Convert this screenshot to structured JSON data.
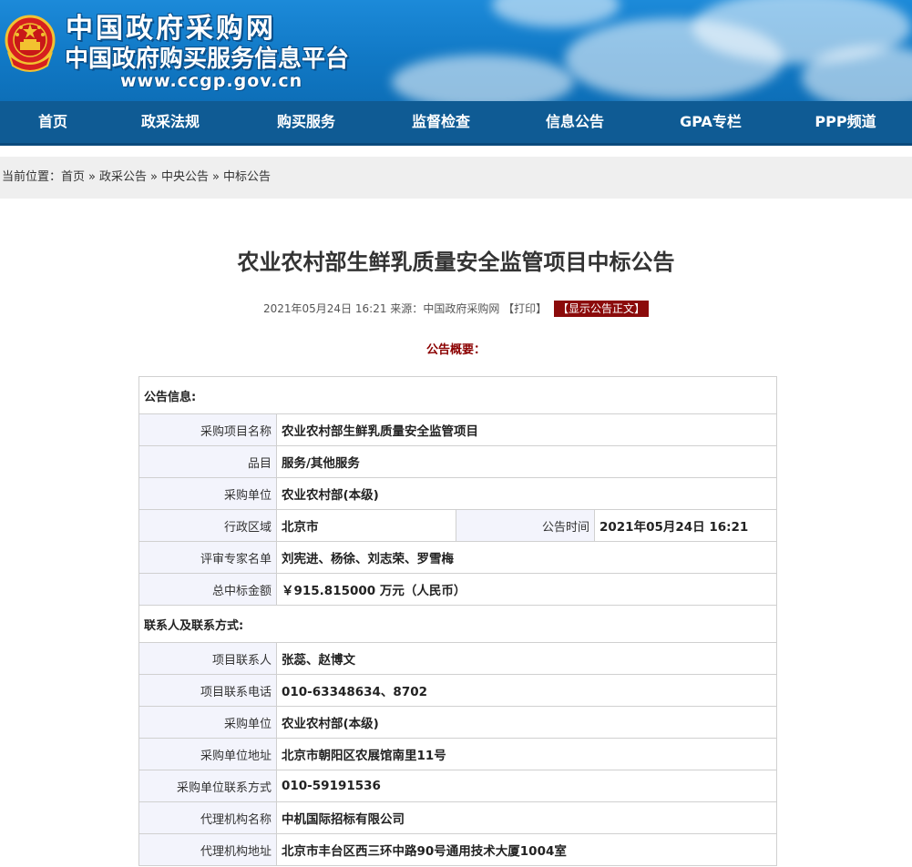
{
  "header": {
    "site_name": "中国政府采购网",
    "site_subname": "中国政府购买服务信息平台",
    "site_url": "www.ccgp.gov.cn",
    "emblem": "national-emblem-icon",
    "colors": {
      "banner": "#1179c6",
      "nav": "#0f5b94",
      "accent": "#8b0b0b"
    }
  },
  "nav": {
    "items": [
      "首页",
      "政采法规",
      "购买服务",
      "监督检查",
      "信息公告",
      "GPA专栏",
      "PPP频道"
    ]
  },
  "breadcrumb": {
    "prefix": "当前位置：",
    "items": [
      "首页",
      "政采公告",
      "中央公告",
      "中标公告"
    ],
    "separator": "»"
  },
  "article": {
    "title": "农业农村部生鲜乳质量安全监管项目中标公告",
    "date": "2021年05月24日 16:21",
    "source_label": "来源：",
    "source": "中国政府采购网",
    "print_label": "【打印】",
    "show_text_label": "【显示公告正文】",
    "overview_label": "公告概要："
  },
  "announcement": {
    "section_info": "公告信息:",
    "project_name_label": "采购项目名称",
    "project_name": "农业农村部生鲜乳质量安全监管项目",
    "category_label": "品目",
    "category": "服务/其他服务",
    "buyer_label": "采购单位",
    "buyer": "农业农村部(本级)",
    "region_label": "行政区域",
    "region": "北京市",
    "publish_time_label": "公告时间",
    "publish_time": "2021年05月24日  16:21",
    "experts_label": "评审专家名单",
    "experts": "刘宪进、杨徐、刘志荣、罗雪梅",
    "amount_label": "总中标金额",
    "amount": "￥915.815000 万元（人民币）",
    "section_contact": "联系人及联系方式:",
    "contact_person_label": "项目联系人",
    "contact_person": "张蕊、赵博文",
    "contact_phone_label": "项目联系电话",
    "contact_phone": "010-63348634、8702",
    "buyer2_label": "采购单位",
    "buyer2": "农业农村部(本级)",
    "buyer_address_label": "采购单位地址",
    "buyer_address": "北京市朝阳区农展馆南里11号",
    "buyer_contact_label": "采购单位联系方式",
    "buyer_contact": "010-59191536",
    "agency_name_label": "代理机构名称",
    "agency_name": "中机国际招标有限公司",
    "agency_address_label": "代理机构地址",
    "agency_address": "北京市丰台区西三环中路90号通用技术大厦1004室"
  }
}
